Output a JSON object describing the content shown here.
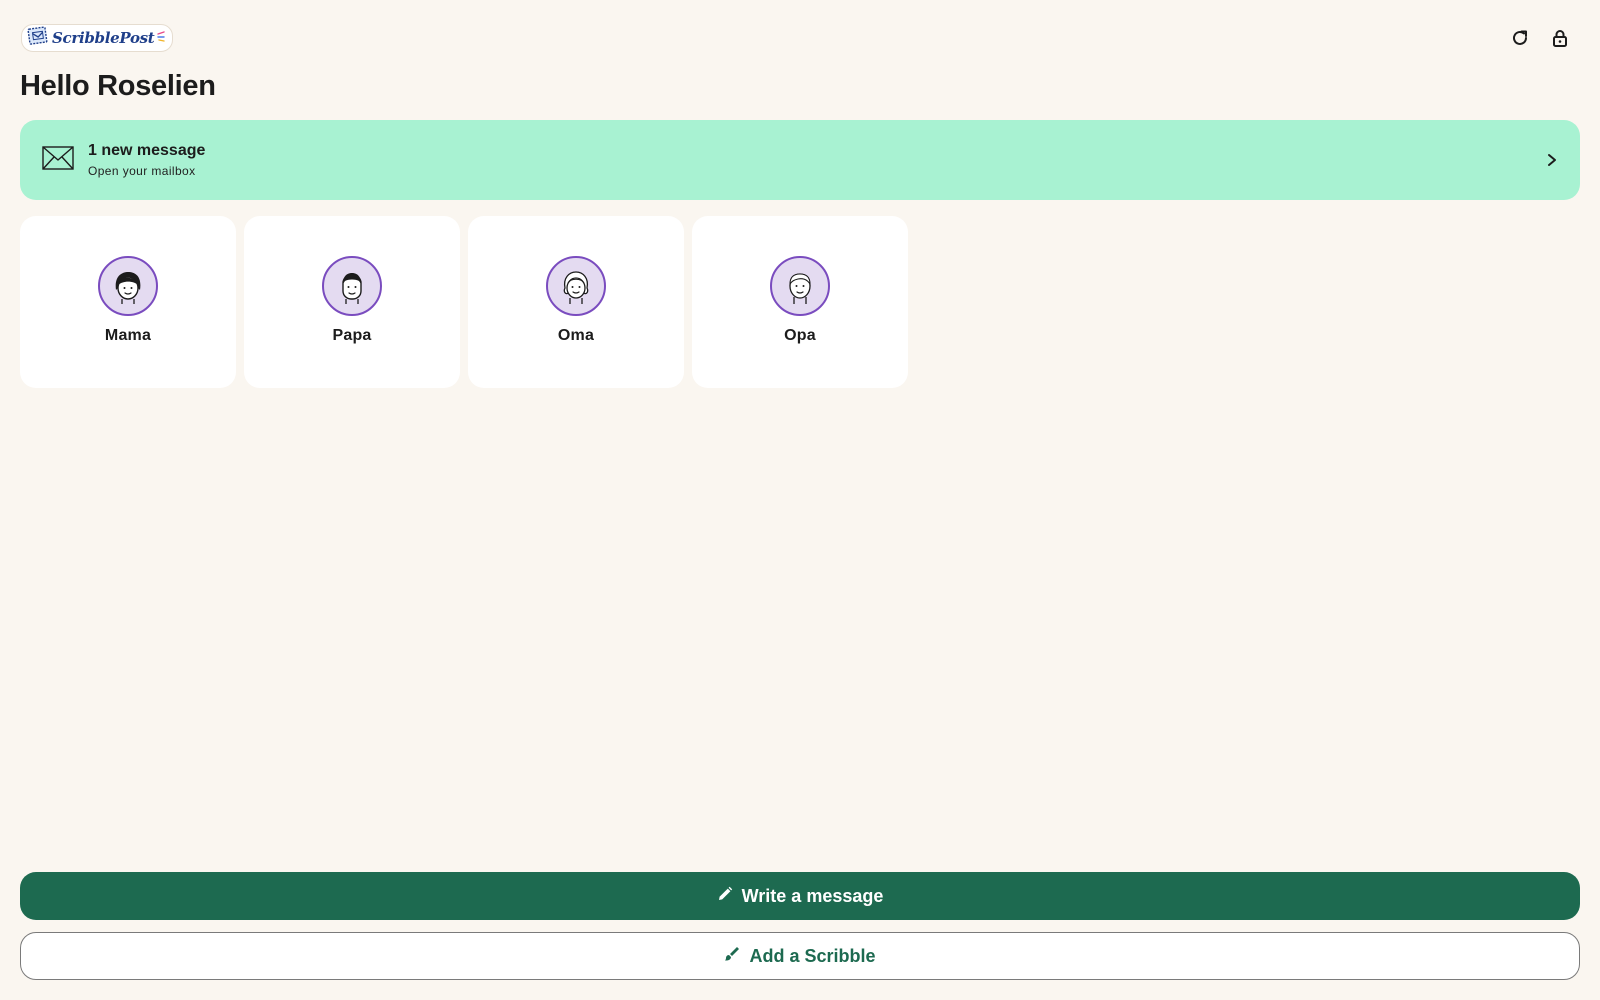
{
  "header": {
    "logo_text": "ScribblePost",
    "refresh_icon": "refresh-icon",
    "lock_icon": "lock-icon"
  },
  "greeting": "Hello Roselien",
  "mailbox": {
    "icon": "envelope-icon",
    "title": "1 new message",
    "subtitle": "Open your mailbox"
  },
  "contacts": [
    {
      "name": "Mama",
      "avatar": "mama-face-icon"
    },
    {
      "name": "Papa",
      "avatar": "papa-face-icon"
    },
    {
      "name": "Oma",
      "avatar": "oma-face-icon"
    },
    {
      "name": "Opa",
      "avatar": "opa-face-icon"
    }
  ],
  "actions": {
    "write_label": "Write a message",
    "scribble_label": "Add a Scribble"
  },
  "colors": {
    "background": "#faf6f0",
    "banner": "#a8f2d2",
    "primary": "#1d6a50",
    "avatar_border": "#7a4cbf",
    "avatar_fill": "#e4dbf1"
  }
}
